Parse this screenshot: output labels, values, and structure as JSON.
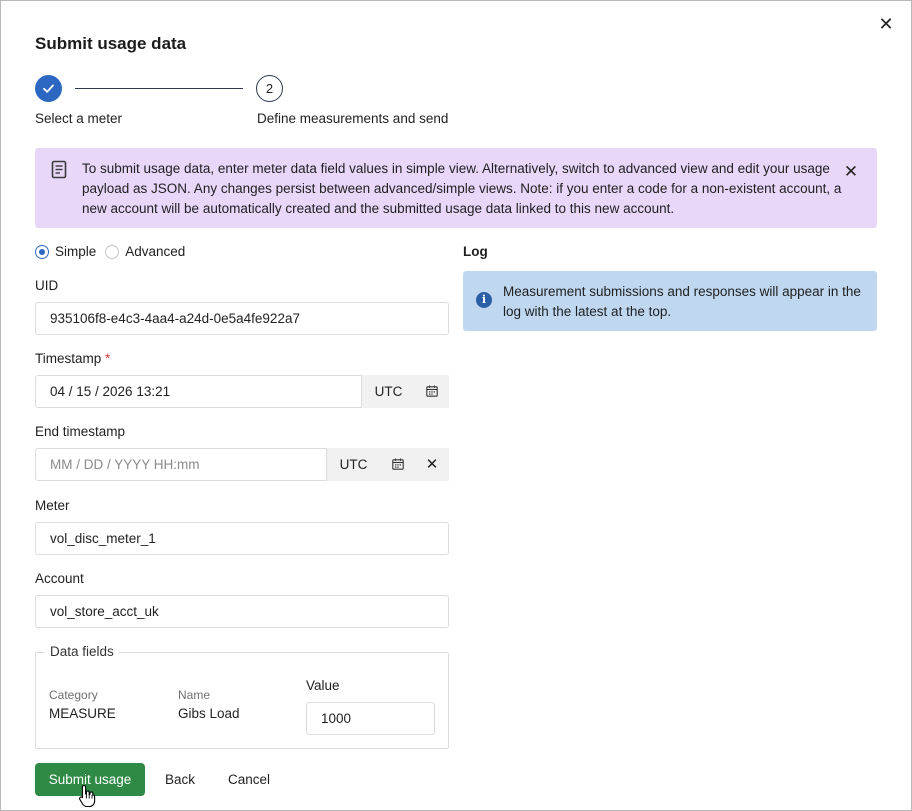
{
  "dialog": {
    "title": "Submit usage data",
    "close_icon": "close-icon"
  },
  "stepper": {
    "steps": [
      {
        "number": "1",
        "label": "Select a meter",
        "status": "complete"
      },
      {
        "number": "2",
        "label": "Define measurements and send",
        "status": "current"
      }
    ]
  },
  "banner": {
    "icon": "document-icon",
    "text": "To submit usage data, enter meter data field values in simple view. Alternatively, switch to advanced view and edit your usage payload as JSON. Any changes persist between advanced/simple views. Note: if you enter a code for a non-existent account, a new account will be automatically created and the submitted usage data linked to this new account.",
    "background": "#e9d7fa"
  },
  "view_mode": {
    "options": [
      "Simple",
      "Advanced"
    ],
    "selected": "Simple"
  },
  "form": {
    "uid": {
      "label": "UID",
      "value": "935106f8-e4c3-4aa4-a24d-0e5a4fe922a7"
    },
    "timestamp": {
      "label": "Timestamp",
      "required_mark": "*",
      "value": "04 / 15 / 2026 13:21",
      "timezone": "UTC"
    },
    "end_timestamp": {
      "label": "End timestamp",
      "placeholder": "MM / DD / YYYY HH:mm",
      "timezone": "UTC"
    },
    "meter": {
      "label": "Meter",
      "value": "vol_disc_meter_1"
    },
    "account": {
      "label": "Account",
      "value": "vol_store_acct_uk"
    }
  },
  "data_fields": {
    "legend": "Data fields",
    "category_label": "Category",
    "category_value": "MEASURE",
    "name_label": "Name",
    "name_value": "Gibs Load",
    "value_label": "Value",
    "value": "1000"
  },
  "actions": {
    "submit": "Submit usage",
    "back": "Back",
    "cancel": "Cancel"
  },
  "log": {
    "title": "Log",
    "info_text": "Measurement submissions and responses will appear in the log with the latest at the top.",
    "background": "#bfd8f0"
  },
  "colors": {
    "primary_blue": "#2c68c2",
    "submit_green": "#2f8a46",
    "required_red": "#d63b3b"
  }
}
